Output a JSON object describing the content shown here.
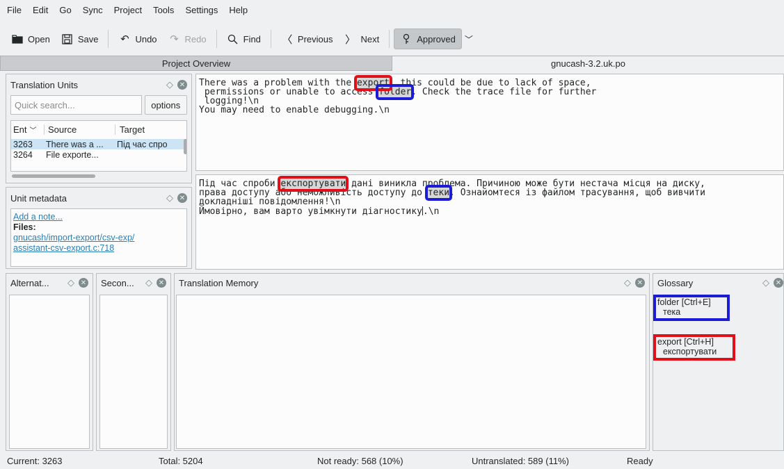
{
  "menu": [
    "File",
    "Edit",
    "Go",
    "Sync",
    "Project",
    "Tools",
    "Settings",
    "Help"
  ],
  "toolbar": {
    "open": "Open",
    "save": "Save",
    "undo": "Undo",
    "redo": "Redo",
    "find": "Find",
    "previous": "Previous",
    "next": "Next",
    "approved": "Approved"
  },
  "tabs": {
    "overview": "Project Overview",
    "file": "gnucash-3.2.uk.po"
  },
  "units_panel": {
    "title": "Translation Units",
    "search_placeholder": "Quick search...",
    "options": "options",
    "col_entry": "Ent",
    "col_source": "Source",
    "col_target": "Target",
    "rows": [
      {
        "entry": "3263",
        "source": "There was a ...",
        "target": "Під час спро"
      },
      {
        "entry": "3264",
        "source": "File exporte...",
        "target": ""
      }
    ]
  },
  "metadata_panel": {
    "title": "Unit metadata",
    "add_note": "Add a note...",
    "files_label": "Files:",
    "file_path_1": "gnucash/import-export/csv-exp/",
    "file_path_2": "assistant-csv-export.c:718"
  },
  "source_text": {
    "l1_a": "There was a problem with the ",
    "l1_hl": "export",
    "l1_b": ", this could be due to lack of space,",
    "l2_a": " permissions or unable to access ",
    "l2_hl": "folder",
    "l2_b": ". Check the trace file for further",
    "l3": " logging!\\n",
    "l4": "You may need to enable debugging.\\n"
  },
  "target_text": {
    "l1_a": "Під час спроби ",
    "l1_hl": "експортувати",
    "l1_b": " дані виникла проблема. Причиною може бути нестача місця на диску,",
    "l2_a": "права доступу або неможливість доступу до ",
    "l2_hl": "теки",
    "l2_b": ". Ознайомтеся із файлом трасування, щоб вивчити",
    "l3": "докладніші повідомлення!\\n",
    "l4_a": "Ймовірно, вам варто увімкнути діагностику",
    "l4_b": ".\\n"
  },
  "bottom_panels": {
    "alternate": "Alternat...",
    "secondary": "Secon...",
    "tm": "Translation Memory",
    "glossary": "Glossary"
  },
  "glossary": [
    {
      "term": "folder [Ctrl+E]",
      "translation": "тека"
    },
    {
      "term": "export [Ctrl+H]",
      "translation": "експортувати"
    }
  ],
  "status": {
    "current": "Current: 3263",
    "total": "Total: 5204",
    "not_ready": "Not ready: 568 (10%)",
    "untranslated": "Untranslated: 589 (11%)",
    "state": "Ready"
  },
  "colors": {
    "highlight_red": "#e0101a",
    "highlight_blue": "#1c1cd4",
    "link": "#2980b9",
    "selection": "#cde4f5"
  },
  "icons": [
    "folder-open-icon",
    "save-icon",
    "undo-icon",
    "redo-icon",
    "search-icon",
    "chevron-left-icon",
    "chevron-right-icon",
    "approved-icon",
    "chevron-down-icon",
    "float-icon",
    "close-icon"
  ]
}
